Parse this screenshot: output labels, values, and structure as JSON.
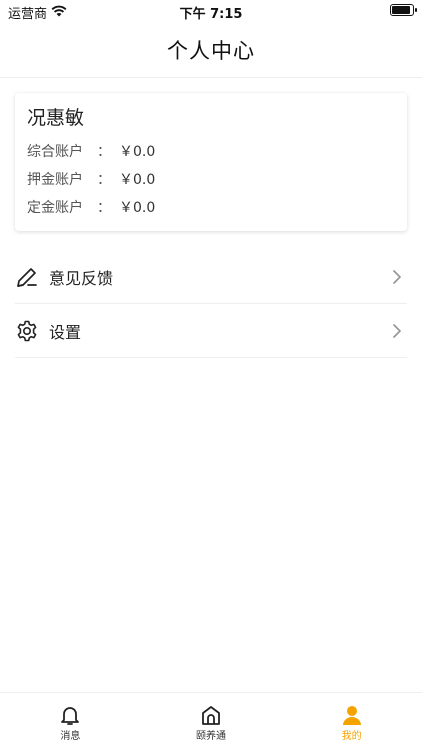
{
  "status_bar": {
    "carrier": "运营商",
    "time": "下午 7:15"
  },
  "header": {
    "title": "个人中心"
  },
  "account_card": {
    "user_name": "况惠敏",
    "rows": [
      {
        "label": "综合账户",
        "separator": "：",
        "value": "￥0.0"
      },
      {
        "label": "押金账户",
        "separator": "：",
        "value": "￥0.0"
      },
      {
        "label": "定金账户",
        "separator": "：",
        "value": "￥0.0"
      }
    ]
  },
  "menu": {
    "items": [
      {
        "label": "意见反馈",
        "icon": "pencil-icon"
      },
      {
        "label": "设置",
        "icon": "gear-icon"
      }
    ]
  },
  "tab_bar": {
    "tabs": [
      {
        "label": "消息",
        "icon": "bell-icon",
        "active": false
      },
      {
        "label": "颐养通",
        "icon": "house-icon",
        "active": false
      },
      {
        "label": "我的",
        "icon": "user-icon",
        "active": true
      }
    ],
    "active_color": "#f5a300",
    "inactive_color": "#222222"
  }
}
